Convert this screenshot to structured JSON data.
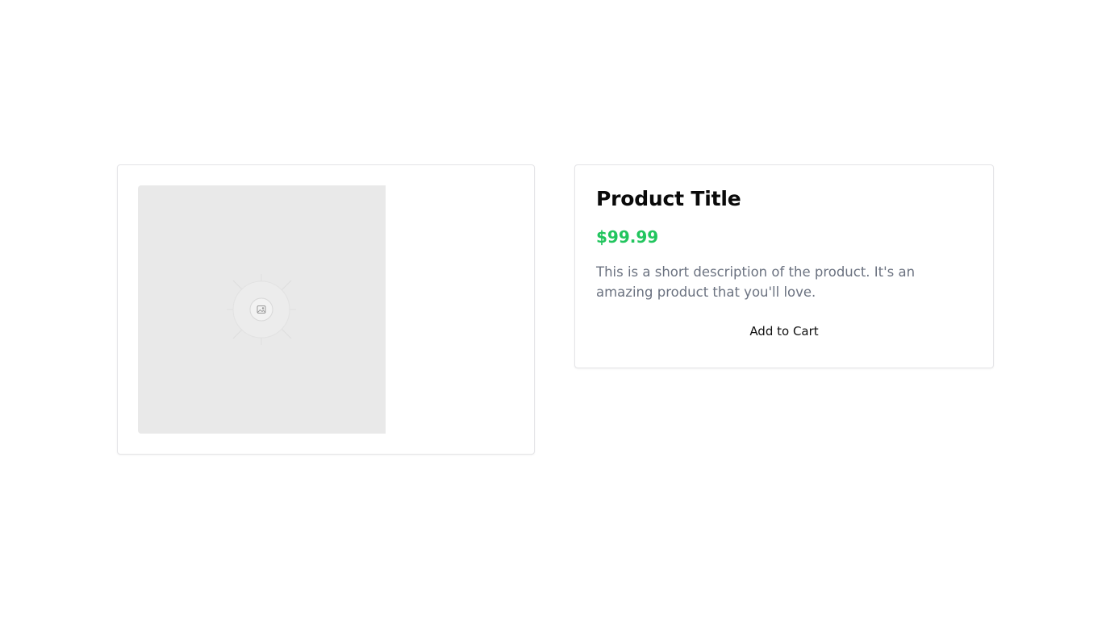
{
  "product": {
    "title": "Product Title",
    "price": "$99.99",
    "description": "This is a short description of the product. It's an amazing product that you'll love.",
    "add_to_cart_label": "Add to Cart",
    "image_icon": "image-placeholder-icon"
  },
  "colors": {
    "price": "#22c55e",
    "description": "#6b7280",
    "image_background": "#e9e9e9"
  }
}
